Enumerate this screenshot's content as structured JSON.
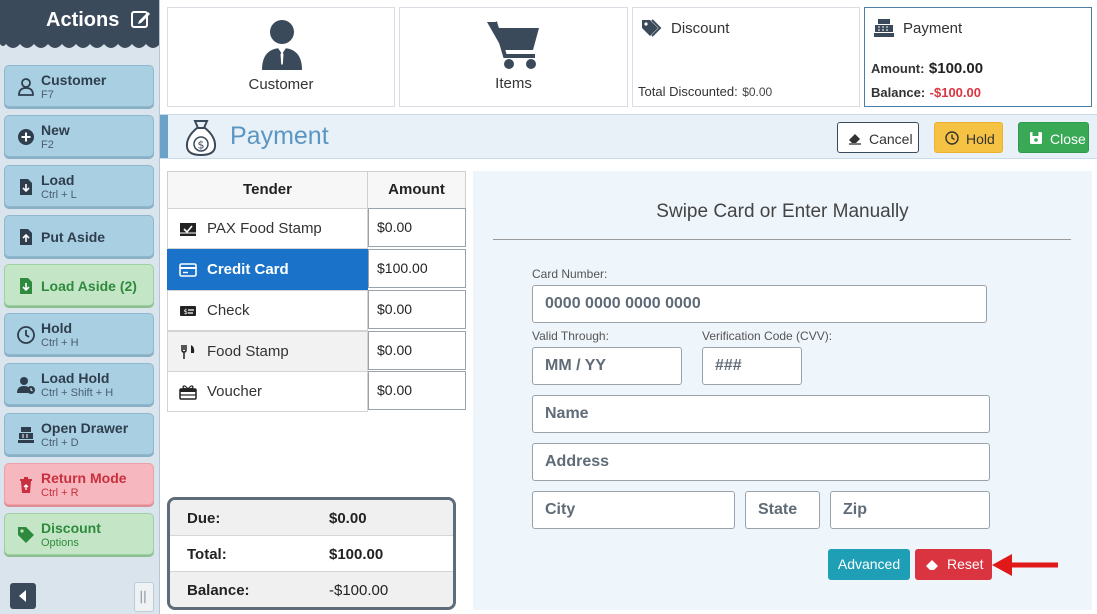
{
  "sidebar": {
    "title": "Actions",
    "items": [
      {
        "label": "Customer",
        "shortcut": "F7"
      },
      {
        "label": "New",
        "shortcut": "F2"
      },
      {
        "label": "Load",
        "shortcut": "Ctrl + L"
      },
      {
        "label": "Put Aside",
        "shortcut": ""
      },
      {
        "label": "Load Aside (2)",
        "shortcut": ""
      },
      {
        "label": "Hold",
        "shortcut": "Ctrl + H"
      },
      {
        "label": "Load Hold",
        "shortcut": "Ctrl + Shift + H"
      },
      {
        "label": "Open Drawer",
        "shortcut": "Ctrl + D"
      },
      {
        "label": "Return Mode",
        "shortcut": "Ctrl + R"
      },
      {
        "label": "Discount",
        "shortcut": "Options"
      }
    ]
  },
  "top_cards": {
    "customer": {
      "label": "Customer"
    },
    "items": {
      "label": "Items"
    },
    "discount": {
      "label": "Discount",
      "total_label": "Total Discounted:",
      "total_value": "$0.00"
    },
    "payment": {
      "label": "Payment",
      "amount_label": "Amount:",
      "amount_value": "$100.00",
      "balance_label": "Balance:",
      "balance_value": "-$100.00"
    }
  },
  "payment_bar": {
    "title": "Payment",
    "cancel_label": "Cancel",
    "hold_label": "Hold",
    "close_label": "Close"
  },
  "tender_table": {
    "headers": {
      "tender": "Tender",
      "amount": "Amount"
    },
    "rows": [
      {
        "label": "PAX Food Stamp",
        "amount": "$0.00"
      },
      {
        "label": "Credit Card",
        "amount": "$100.00"
      },
      {
        "label": "Check",
        "amount": "$0.00"
      },
      {
        "label": "Food Stamp",
        "amount": "$0.00"
      },
      {
        "label": "Voucher",
        "amount": "$0.00"
      }
    ]
  },
  "totals": {
    "due_label": "Due:",
    "due_value": "$0.00",
    "total_label": "Total:",
    "total_value": "$100.00",
    "balance_label": "Balance:",
    "balance_value": "-$100.00"
  },
  "card_form": {
    "title": "Swipe Card or Enter Manually",
    "card_number_label": "Card Number:",
    "card_number_placeholder": "0000 0000 0000 0000",
    "valid_through_label": "Valid Through:",
    "valid_through_placeholder": "MM / YY",
    "cvv_label": "Verification Code (CVV):",
    "cvv_placeholder": "###",
    "name_placeholder": "Name",
    "address_placeholder": "Address",
    "city_placeholder": "City",
    "state_placeholder": "State",
    "zip_placeholder": "Zip",
    "advanced_label": "Advanced",
    "reset_label": "Reset"
  },
  "colors": {
    "sidebar_header": "#3b4a5b",
    "selected_row": "#1b73c9",
    "balance_negative": "#d9343f",
    "hold": "#f5c244",
    "close": "#3aa956",
    "advanced": "#1e9fb5",
    "reset": "#d9343f",
    "payment_title": "#5b96c2"
  }
}
